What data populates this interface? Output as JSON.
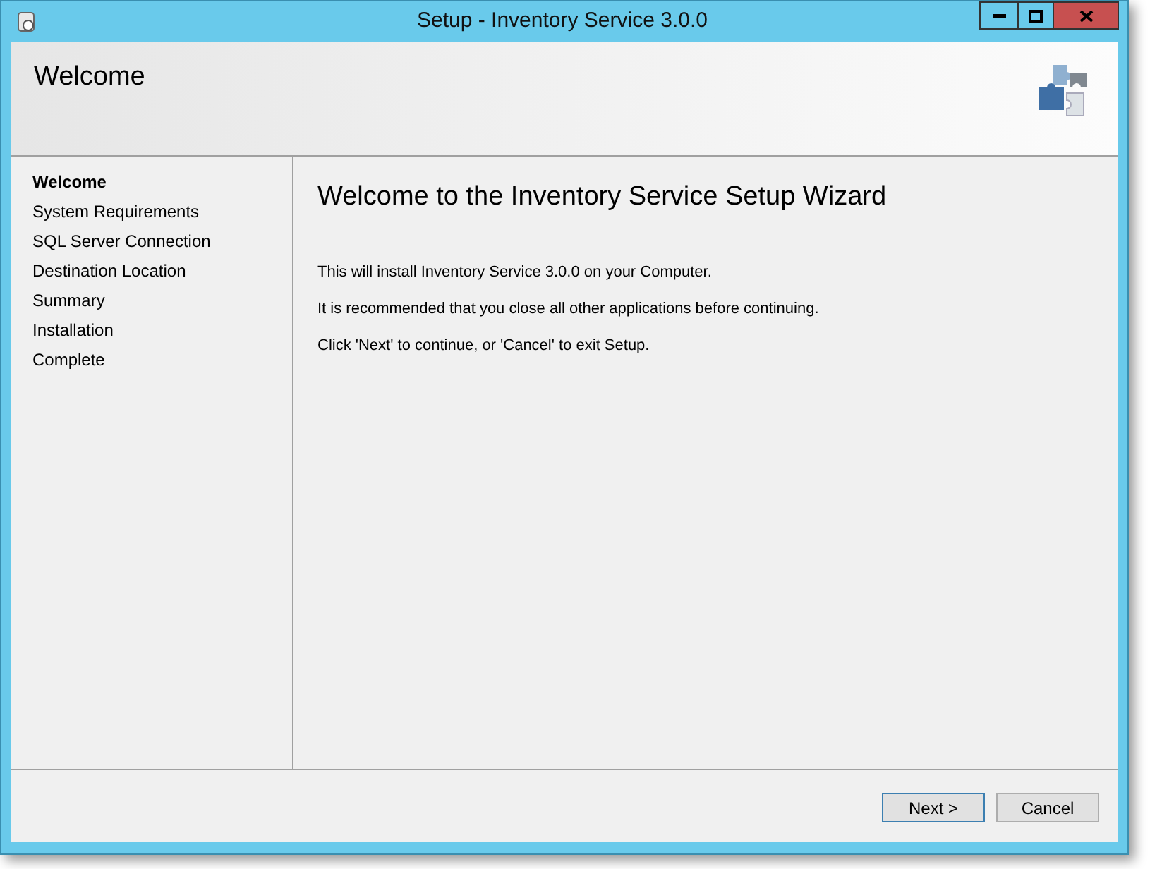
{
  "window": {
    "title": "Setup - Inventory Service 3.0.0"
  },
  "header": {
    "title": "Welcome"
  },
  "steps": [
    {
      "label": "Welcome",
      "selected": true
    },
    {
      "label": "System Requirements",
      "selected": false
    },
    {
      "label": "SQL Server Connection",
      "selected": false
    },
    {
      "label": "Destination Location",
      "selected": false
    },
    {
      "label": "Summary",
      "selected": false
    },
    {
      "label": "Installation",
      "selected": false
    },
    {
      "label": "Complete",
      "selected": false
    }
  ],
  "content": {
    "heading": "Welcome to the Inventory Service Setup Wizard",
    "paragraphs": [
      "This will install Inventory Service 3.0.0 on your Computer.",
      "It is recommended that you close all other applications before continuing.",
      "Click 'Next' to continue, or 'Cancel' to exit Setup."
    ]
  },
  "buttons": [
    {
      "label": "Next >",
      "focused": true
    },
    {
      "label": "Cancel",
      "focused": false
    }
  ]
}
